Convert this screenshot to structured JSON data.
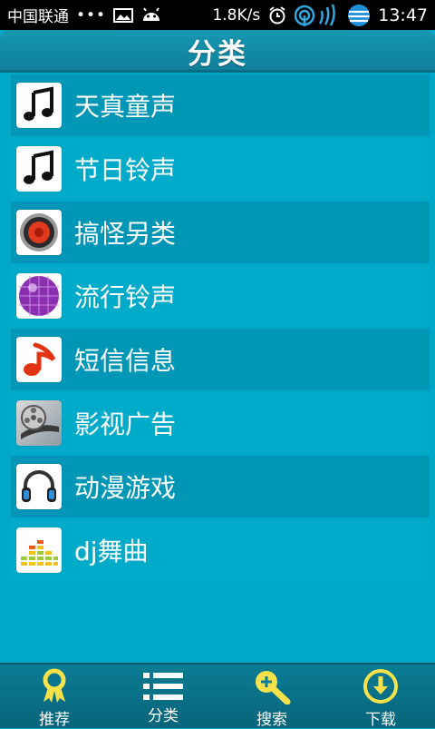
{
  "status_bar": {
    "carrier": "中国联通",
    "dots": "•••",
    "speed": "1.8K/s",
    "time": "13:47"
  },
  "header": {
    "title": "分类"
  },
  "categories": [
    {
      "label": "天真童声",
      "icon": "music-note-icon"
    },
    {
      "label": "节日铃声",
      "icon": "music-note-icon"
    },
    {
      "label": "搞怪另类",
      "icon": "speaker-icon"
    },
    {
      "label": "流行铃声",
      "icon": "disco-ball-icon"
    },
    {
      "label": "短信信息",
      "icon": "red-music-note-icon"
    },
    {
      "label": "影视广告",
      "icon": "film-reel-icon"
    },
    {
      "label": "动漫游戏",
      "icon": "headphones-icon"
    },
    {
      "label": "dj舞曲",
      "icon": "equalizer-icon"
    }
  ],
  "bottom_nav": [
    {
      "label": "推荐",
      "icon": "ribbon-icon"
    },
    {
      "label": "分类",
      "icon": "list-icon"
    },
    {
      "label": "搜索",
      "icon": "search-plus-icon"
    },
    {
      "label": "下载",
      "icon": "download-icon"
    }
  ],
  "colors": {
    "background": "#00a7c6",
    "row_dark": "#0096b6",
    "row_light": "#00aac9",
    "nav_icon": "#f5e24a"
  }
}
